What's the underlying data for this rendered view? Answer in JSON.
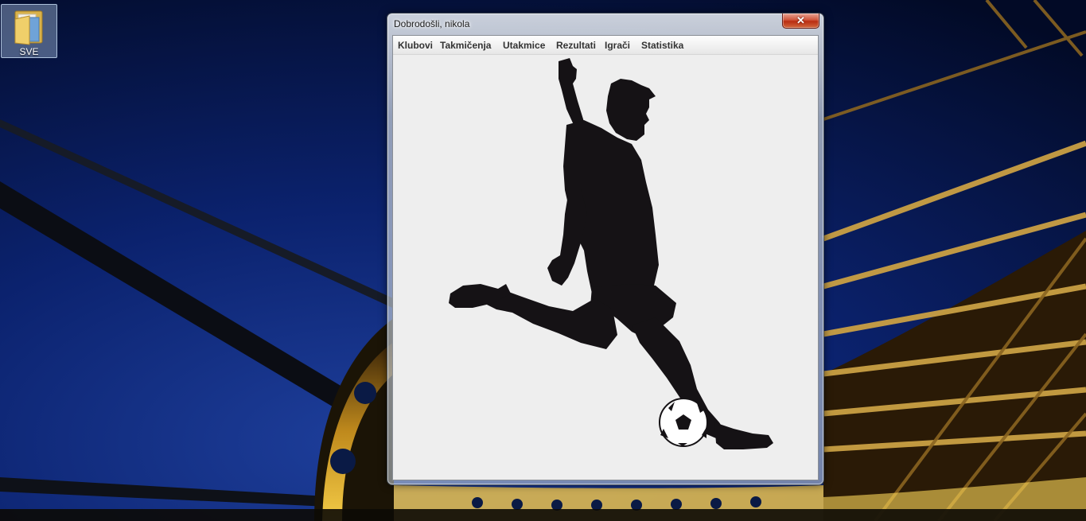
{
  "desktop": {
    "icons": [
      {
        "label": "SVE",
        "icon": "folder-icon"
      }
    ]
  },
  "window": {
    "title": "Dobrodošli, nikola",
    "close_label": "✕",
    "menu": [
      {
        "label": "Klubovi"
      },
      {
        "label": "Takmičenja"
      },
      {
        "label": "Utakmice"
      },
      {
        "label": "Rezultati"
      },
      {
        "label": "Igrači"
      },
      {
        "label": "Statistika"
      }
    ],
    "content_image": "football-player-kicking-ball-silhouette"
  }
}
